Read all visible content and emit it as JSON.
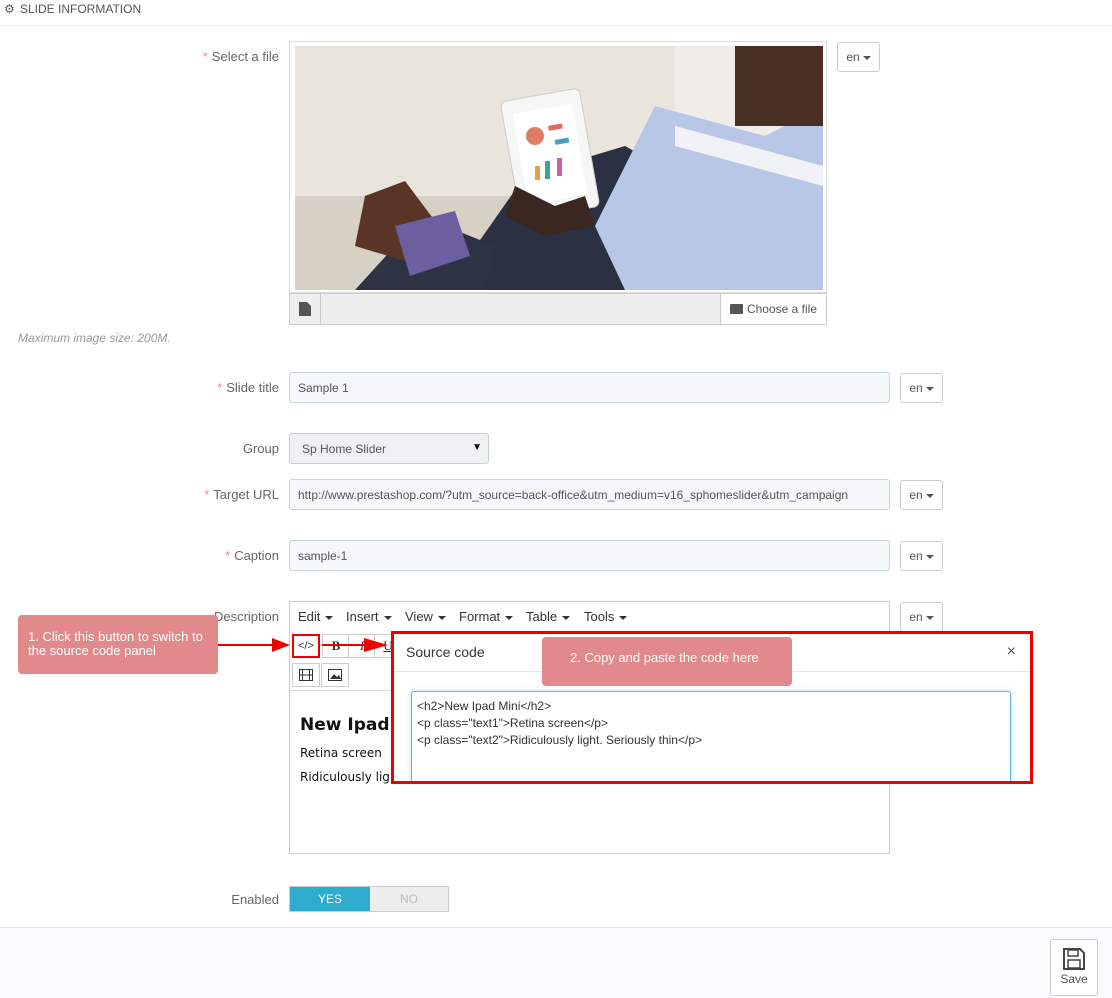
{
  "header": {
    "title": "SLIDE INFORMATION",
    "icon": "gears-icon"
  },
  "lang": "en",
  "fields": {
    "file": {
      "label": "Select a file",
      "choose_label": "Choose a file",
      "hint": "Maximum image size: 200M."
    },
    "slide_title": {
      "label": "Slide title",
      "value": "Sample 1"
    },
    "group": {
      "label": "Group",
      "value": "Sp Home Slider"
    },
    "target_url": {
      "label": "Target URL",
      "value": "http://www.prestashop.com/?utm_source=back-office&utm_medium=v16_sphomeslider&utm_campaign"
    },
    "caption": {
      "label": "Caption",
      "value": "sample-1"
    },
    "description": {
      "label": "Description"
    },
    "enabled": {
      "label": "Enabled",
      "yes": "YES",
      "no": "NO"
    }
  },
  "editor": {
    "menu": [
      "Edit",
      "Insert",
      "View",
      "Format",
      "Table",
      "Tools"
    ],
    "content": {
      "heading": "New Ipad",
      "line1": "Retina screen",
      "line2": "Ridiculously ligh"
    }
  },
  "source_modal": {
    "title": "Source code",
    "close": "×",
    "code": [
      "<h2>New Ipad Mini</h2>",
      "<p class=\"text1\">Retina screen</p>",
      "<p class=\"text2\">Ridiculously light. Seriously thin</p>"
    ]
  },
  "callouts": {
    "step1": "1. Click this button to switch to the source code panel",
    "step2": "2. Copy and paste the code here"
  },
  "footer": {
    "save_label": "Save"
  },
  "colors": {
    "accent": "#2eacce",
    "callout": "#e2898c",
    "highlight": "#ee0000",
    "required": "#e08f95"
  }
}
